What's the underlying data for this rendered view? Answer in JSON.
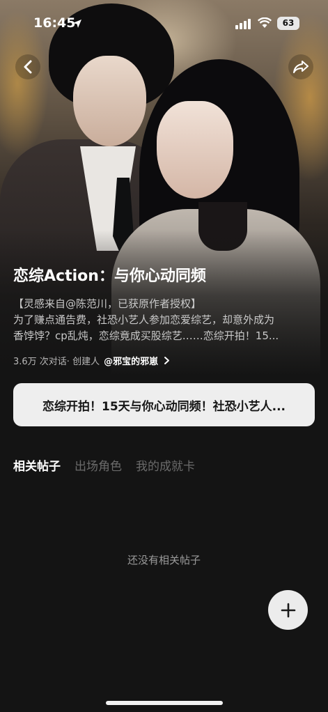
{
  "status_bar": {
    "time": "16:45",
    "battery": "63"
  },
  "story": {
    "title": "恋综Action：与你心动同频",
    "description_lines": [
      "【灵感来自@陈范川，已获原作者授权】",
      "为了赚点通告费，社恐小艺人参加恋爱综艺，却意外成为",
      "香饽饽？cp乱炖，恋综竟成买股综艺……恋综开拍！15..."
    ],
    "stats": "3.6万 次对话· 创建人",
    "creator": "@邪宝的邪崽"
  },
  "card": {
    "text": "恋综开拍！15天与你心动同频！社恐小艺人..."
  },
  "tabs": [
    {
      "label": "相关帖子",
      "active": true
    },
    {
      "label": "出场角色",
      "active": false
    },
    {
      "label": "我的成就卡",
      "active": false
    }
  ],
  "empty_state": "还没有相关帖子",
  "icons": {
    "back": "chevron-left-icon",
    "share": "share-icon",
    "add": "plus-icon",
    "signal": "cellular-signal-icon",
    "wifi": "wifi-icon",
    "location": "location-arrow-icon"
  },
  "colors": {
    "background": "#141414",
    "card": "#eeeeee",
    "tab_active": "#ffffff",
    "tab_inactive": "#6b6b6b"
  }
}
